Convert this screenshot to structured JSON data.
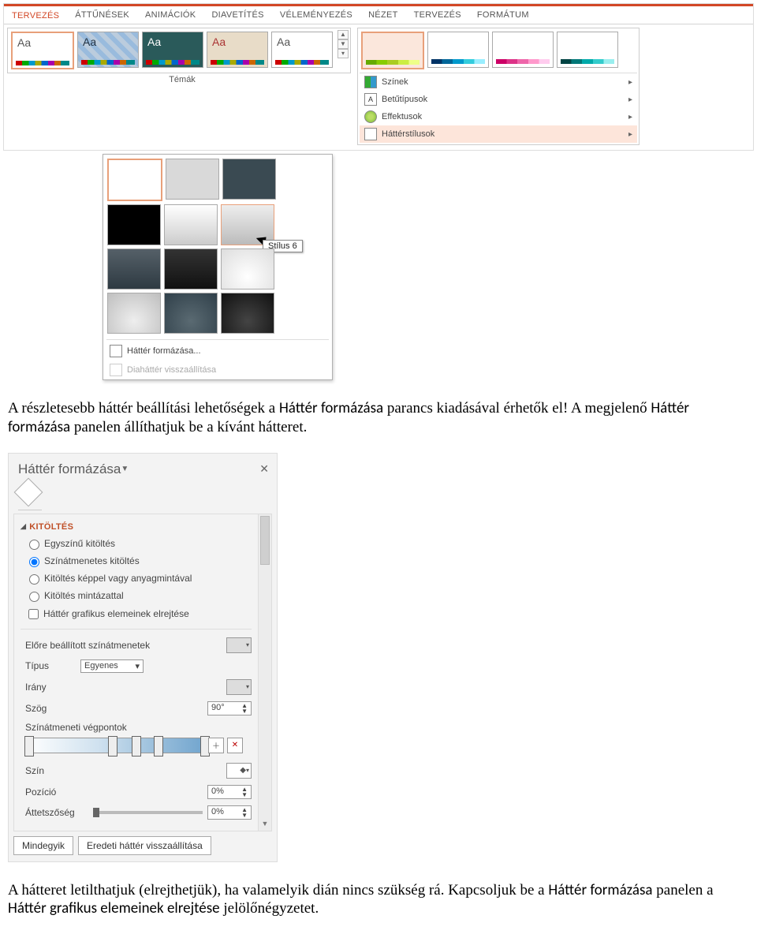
{
  "ribbon": {
    "tabs": [
      "TERVEZÉS",
      "ÁTTŰNÉSEK",
      "ANIMÁCIÓK",
      "DIAVETÍTÉS",
      "VÉLEMÉNYEZÉS",
      "NÉZET",
      "TERVEZÉS",
      "FORMÁTUM"
    ],
    "themes_caption": "Témák",
    "variant_menu": {
      "colors": "Színek",
      "fonts": "Betűtípusok",
      "effects": "Effektusok",
      "bgstyles": "Háttérstílusok"
    }
  },
  "bg_styles": {
    "tooltip": "Stílus 6",
    "format": "Háttér formázása...",
    "reset": "Diaháttér visszaállítása"
  },
  "para1": {
    "t1": "A részletesebb háttér beállítási lehetőségek a ",
    "b1": "Háttér formázása",
    "t2": " parancs kiadásával érhetők el! A megjelenő ",
    "b2": "Háttér formázása",
    "t3": " panelen állíthatjuk be a kívánt hátteret."
  },
  "pane": {
    "title": "Háttér formázása",
    "section": "KITÖLTÉS",
    "r_solid": "Egyszínű kitöltés",
    "r_gradient": "Színátmenetes kitöltés",
    "r_picture": "Kitöltés képpel vagy anyagmintával",
    "r_pattern": "Kitöltés mintázattal",
    "c_hide": "Háttér grafikus elemeinek elrejtése",
    "f_presets_label": "Előre beállított színátmenetek",
    "f_type_label": "Típus",
    "f_type_value": "Egyenes",
    "f_dir_label": "Irány",
    "f_angle_label": "Szög",
    "f_angle_value": "90°",
    "f_stops_label": "Színátmeneti végpontok",
    "f_color_label": "Szín",
    "f_pos_label": "Pozíció",
    "f_pos_value": "0%",
    "f_trans_label": "Áttetszőség",
    "f_trans_value": "0%",
    "btn_all": "Mindegyik",
    "btn_reset": "Eredeti háttér visszaállítása"
  },
  "para2": {
    "t1": "A hátteret letilthatjuk (elrejthetjük), ha valamelyik dián nincs szükség rá. Kapcsoljuk be a ",
    "b1": "Háttér formázása",
    "t2": " panelen a ",
    "b2": "Háttér grafikus elemeinek elrejtése",
    "t3": " jelölőnégyzetet."
  }
}
